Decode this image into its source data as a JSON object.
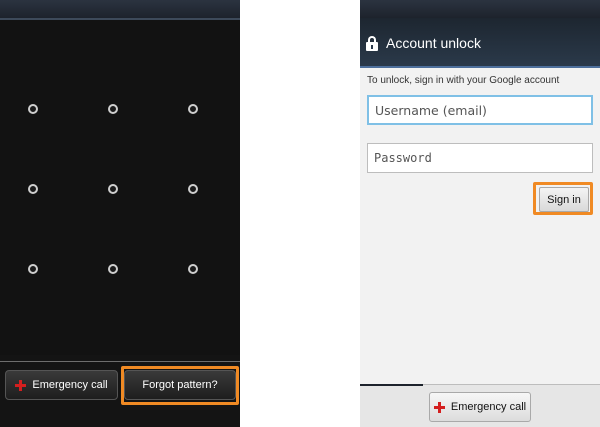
{
  "pattern_lock": {
    "dots": 9,
    "emergency_call_label": "Emergency call",
    "forgot_pattern_label": "Forgot pattern?"
  },
  "account_unlock": {
    "title": "Account unlock",
    "instructions": "To unlock, sign in with your Google account",
    "username_placeholder": "Username (email)",
    "password_placeholder": "Password",
    "sign_in_label": "Sign in",
    "emergency_call_label": "Emergency call"
  },
  "icons": {
    "lock": "lock-icon",
    "emergency": "red-cross-icon"
  },
  "colors": {
    "highlight": "#f08a24",
    "emergency_cross": "#d41f1f",
    "input_focus": "#7fc0e6"
  }
}
